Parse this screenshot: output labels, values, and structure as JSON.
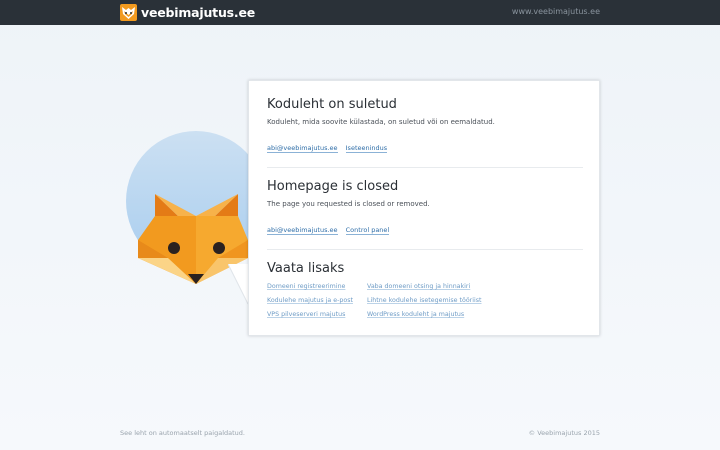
{
  "header": {
    "logo_text": "veebimajutus",
    "logo_tld": ".ee",
    "site_url": "www.veebimajutus.ee",
    "logo_icon": "fox-icon"
  },
  "sections": {
    "estonian": {
      "title": "Koduleht on suletud",
      "description": "Koduleht, mida soovite külastada, on suletud või on eemaldatud.",
      "links": [
        "abi@veebimajutus.ee",
        "Iseteenindus"
      ]
    },
    "english": {
      "title": "Homepage is closed",
      "description": "The page you requested is closed or removed.",
      "links": [
        "abi@veebimajutus.ee",
        "Control panel"
      ]
    },
    "more": {
      "title": "Vaata lisaks",
      "links": [
        "Domeeni registreerimine",
        "Vaba domeeni otsing ja hinnakiri",
        "Kodulehe majutus ja e-post",
        "Lihtne kodulehe isetegemise tööriist",
        "VPS pilveserveri majutus",
        "WordPress koduleht ja majutus"
      ]
    }
  },
  "footer": {
    "left": "See leht on automaatselt paigaldatud.",
    "right": "© Veebimajutus 2015"
  },
  "colors": {
    "topbar": "#2a3138",
    "fox_orange": "#f29a1f",
    "fox_dark": "#e47b16",
    "link": "#2f6ea8"
  }
}
